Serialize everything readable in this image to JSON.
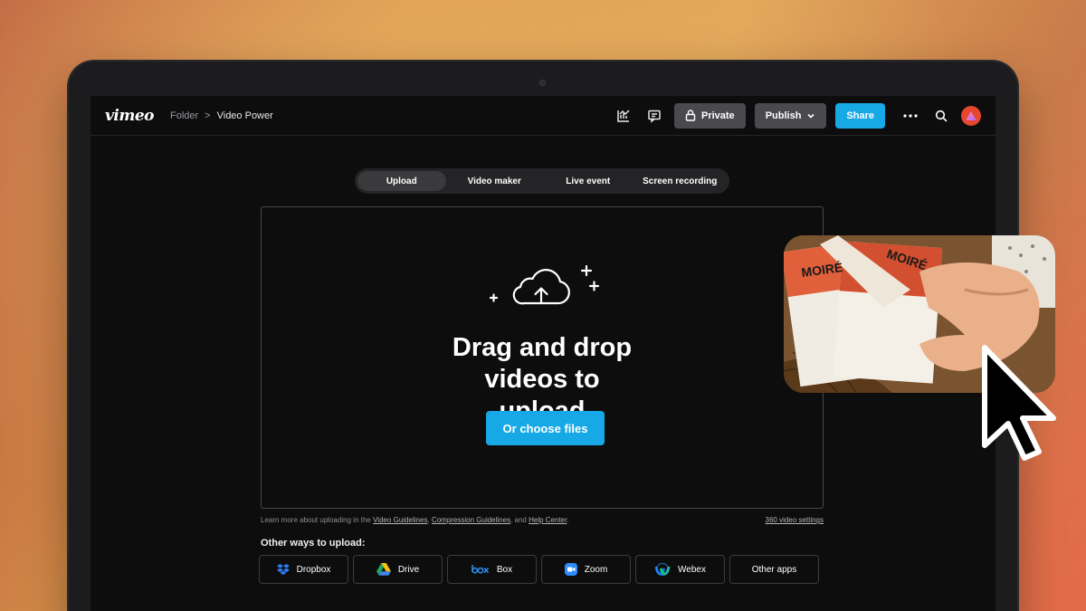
{
  "app": {
    "logo_text": "vimeo",
    "breadcrumb": {
      "folder": "Folder",
      "separator": ">",
      "current": "Video Power"
    }
  },
  "toolbar": {
    "analytics_icon": "analytics-chart-icon",
    "comments_icon": "comments-icon",
    "private_label": "Private",
    "publish_label": "Publish",
    "share_label": "Share",
    "more_icon": "more-dots-icon",
    "search_icon": "search-icon"
  },
  "tabs": [
    {
      "label": "Upload",
      "active": true
    },
    {
      "label": "Video maker",
      "active": false
    },
    {
      "label": "Live event",
      "active": false
    },
    {
      "label": "Screen recording",
      "active": false
    }
  ],
  "dropzone": {
    "title": "Drag and drop videos to upload",
    "choose_label": "Or choose files"
  },
  "learn_more": {
    "prefix": "Learn more about uploading in the",
    "link1": "Video Guidelines",
    "sep1": ",",
    "link2": "Compression Guidelines",
    "sep2": ", and",
    "link3": "Help Center",
    "suffix": ".",
    "settings_link": "360 video settings"
  },
  "other_ways": {
    "label": "Other ways to upload:",
    "providers": [
      {
        "label": "Dropbox",
        "icon": "dropbox-icon"
      },
      {
        "label": "Drive",
        "icon": "google-drive-icon"
      },
      {
        "label": "Box",
        "icon": "box-icon"
      },
      {
        "label": "Zoom",
        "icon": "zoom-icon"
      },
      {
        "label": "Webex",
        "icon": "webex-icon"
      },
      {
        "label": "Other apps",
        "icon": ""
      }
    ]
  },
  "thumbnail": {
    "brand_text": "MOIRÉ"
  },
  "colors": {
    "accent": "#17a9e6",
    "avatar": "#e5462c",
    "screen_bg": "#0d0d0e"
  }
}
